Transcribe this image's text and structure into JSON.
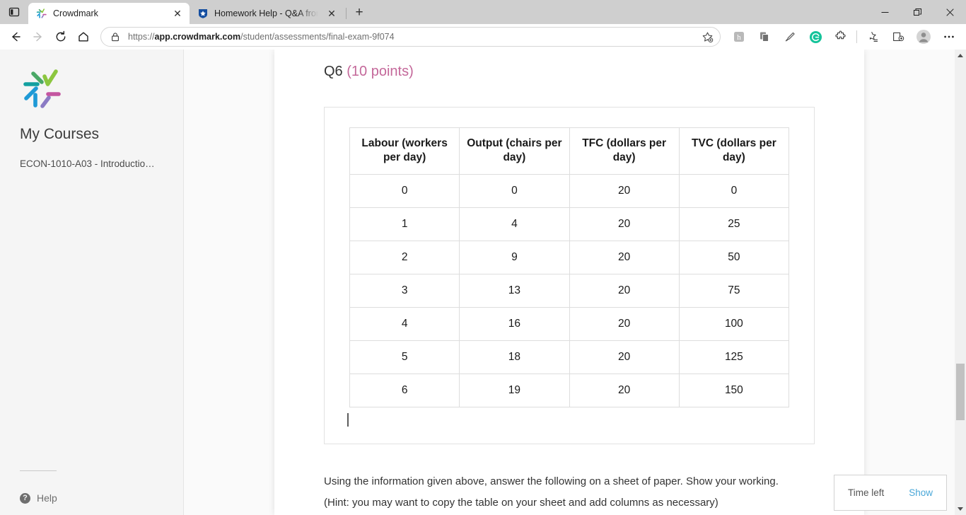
{
  "browser": {
    "sidebar_toggle_label": "",
    "tabs": [
      {
        "title": "Crowdmark",
        "favicon": "crowdmark-logo-icon",
        "active": true,
        "close_glyph": "✕"
      },
      {
        "title": "Homework Help - Q&A from On",
        "favicon": "chegg-shield-icon",
        "active": false,
        "close_glyph": "✕"
      }
    ],
    "new_tab_glyph": "+",
    "window_controls": {
      "minimize": "—",
      "restore": "❐",
      "close": "✕"
    },
    "nav": {
      "back": "←",
      "forward": "→",
      "reload": "↻",
      "home": "⌂"
    },
    "address": {
      "scheme": "https://",
      "domain": "app.crowdmark.com",
      "path": "/student/assessments/final-exam-9f074",
      "full_url": "https://app.crowdmark.com/student/assessments/final-exam-9f074",
      "lock_icon": "lock-icon"
    },
    "extensions": [
      {
        "name": "add-to-favorites-icon"
      },
      {
        "name": "extension-h-icon",
        "label": "h"
      },
      {
        "name": "extension-copy-icon"
      },
      {
        "name": "extension-pen-icon"
      },
      {
        "name": "grammarly-icon",
        "label": "G",
        "color": "#15c39a"
      },
      {
        "name": "extensions-puzzle-icon"
      },
      {
        "name": "collections-icon"
      },
      {
        "name": "split-screen-icon"
      },
      {
        "name": "profile-avatar-icon"
      },
      {
        "name": "settings-more-icon",
        "label": "…"
      }
    ]
  },
  "sidebar": {
    "logo_name": "crowdmark-logo",
    "heading": "My Courses",
    "courses": [
      {
        "label": "ECON-1010-A03 - Introductio…"
      }
    ],
    "help": {
      "icon": "help-circle-icon",
      "glyph": "?",
      "label": "Help"
    }
  },
  "question": {
    "number": "Q6",
    "points": "(10 points)",
    "points_color": "#c4689a"
  },
  "table": {
    "headers": [
      "Labour (workers per day)",
      "Output (chairs per day)",
      "TFC (dollars per day)",
      "TVC (dollars per day)"
    ],
    "rows": [
      [
        "0",
        "0",
        "20",
        "0"
      ],
      [
        "1",
        "4",
        "20",
        "25"
      ],
      [
        "2",
        "9",
        "20",
        "50"
      ],
      [
        "3",
        "13",
        "20",
        "75"
      ],
      [
        "4",
        "16",
        "20",
        "100"
      ],
      [
        "5",
        "18",
        "20",
        "125"
      ],
      [
        "6",
        "19",
        "20",
        "150"
      ]
    ]
  },
  "instructions": {
    "line1": "Using the information given above, answer the following on a sheet of paper. Show your working.",
    "line2": "(Hint: you may want to copy the table on your sheet and add columns as necessary)"
  },
  "time_left_widget": {
    "label": "Time left",
    "action": "Show",
    "action_color": "#49a7d8"
  },
  "scrollbar": {
    "up_glyph": "▲",
    "down_glyph": "▼",
    "thumb_position_pct": 68.5
  }
}
